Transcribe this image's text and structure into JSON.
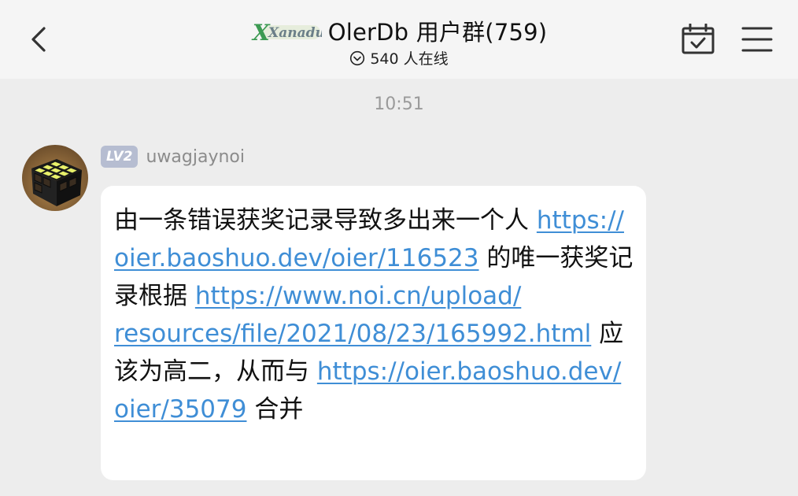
{
  "header": {
    "back_icon": "chevron-left-icon",
    "logo_text": "Xanadu",
    "title": "OlerDb 用户群(759)",
    "online_icon": "chevron-circle-down-icon",
    "online_text": "540 人在线",
    "calendar_icon": "calendar-check-icon",
    "menu_icon": "hamburger-menu-icon"
  },
  "chat": {
    "timestamp": "10:51",
    "messages": [
      {
        "avatar_icon": "rubiks-cube-avatar",
        "level": "LV2",
        "sender": "uwagjaynoi",
        "segments": [
          {
            "type": "text",
            "text": "由一条错误获奖记录导致多出来一个人 "
          },
          {
            "type": "link",
            "text": "https://oier.baoshuo.dev/oier/116523"
          },
          {
            "type": "text",
            "text": " 的唯一获奖记录根据 "
          },
          {
            "type": "link",
            "text": "https://www.noi.cn/upload/resources/file/2021/08/23/165992.html"
          },
          {
            "type": "text",
            "text": " 应该为高二，从而与 "
          },
          {
            "type": "link",
            "text": "https://oier.baoshuo.dev/oier/35079"
          },
          {
            "type": "text",
            "text": " 合并"
          }
        ]
      }
    ]
  },
  "colors": {
    "page_background": "#ededed",
    "header_background": "#f5f5f5",
    "bubble_background": "#ffffff",
    "link": "#3f8ed6",
    "level_badge": "#b6bdd1",
    "muted_text": "#9a9a9a"
  }
}
